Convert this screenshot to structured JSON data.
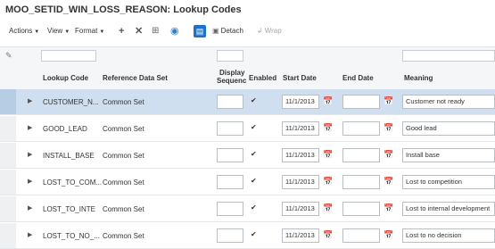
{
  "title": "MOO_SETID_WIN_LOSS_REASON: Lookup Codes",
  "toolbar": {
    "actions": "Actions",
    "view": "View",
    "format": "Format",
    "detach": "Detach",
    "wrap": "Wrap"
  },
  "columns": {
    "lookup_code": "Lookup Code",
    "reference_data_set": "Reference Data Set",
    "display_sequence_line1": "Display",
    "display_sequence_line2": "Sequenc",
    "enabled": "Enabled",
    "start_date": "Start Date",
    "end_date": "End Date",
    "meaning": "Meaning"
  },
  "rows": [
    {
      "lookup_code": "CUSTOMER_N...",
      "reference_data_set": "Common Set",
      "display_sequence": "",
      "enabled": true,
      "start_date": "11/1/2013",
      "end_date": "",
      "meaning": "Customer not ready",
      "selected": true
    },
    {
      "lookup_code": "GOOD_LEAD",
      "reference_data_set": "Common Set",
      "display_sequence": "",
      "enabled": true,
      "start_date": "11/1/2013",
      "end_date": "",
      "meaning": "Good lead",
      "selected": false
    },
    {
      "lookup_code": "INSTALL_BASE",
      "reference_data_set": "Common Set",
      "display_sequence": "",
      "enabled": true,
      "start_date": "11/1/2013",
      "end_date": "",
      "meaning": "Install base",
      "selected": false
    },
    {
      "lookup_code": "LOST_TO_COM...",
      "reference_data_set": "Common Set",
      "display_sequence": "",
      "enabled": true,
      "start_date": "11/1/2013",
      "end_date": "",
      "meaning": "Lost to competition",
      "selected": false
    },
    {
      "lookup_code": "LOST_TO_INTE",
      "reference_data_set": "Common Set",
      "display_sequence": "",
      "enabled": true,
      "start_date": "11/1/2013",
      "end_date": "",
      "meaning": "Lost to internal development",
      "selected": false
    },
    {
      "lookup_code": "LOST_TO_NO_...",
      "reference_data_set": "Common Set",
      "display_sequence": "",
      "enabled": true,
      "start_date": "11/1/2013",
      "end_date": "",
      "meaning": "Lost to no decision",
      "selected": false
    }
  ],
  "colors": {
    "accent": "#1b72c8",
    "selected_row": "#cfdff0"
  }
}
